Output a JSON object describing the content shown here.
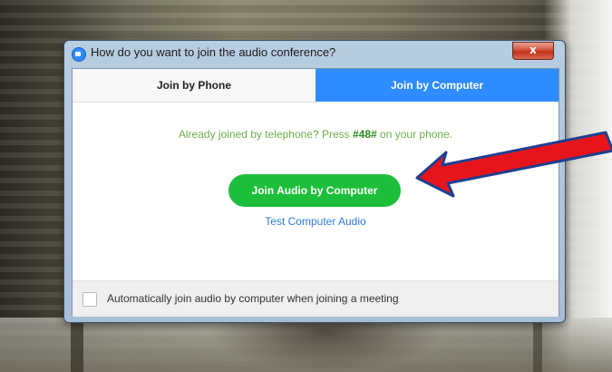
{
  "dialog": {
    "title": "How do you want to join the audio conference?",
    "close_label": "x",
    "tabs": [
      {
        "label": "Join by Phone",
        "selected": false
      },
      {
        "label": "Join by Computer",
        "selected": true
      }
    ],
    "status": {
      "prefix": "Already joined by telephone? Press ",
      "code": "#48#",
      "suffix": " on your phone."
    },
    "join_button_label": "Join Audio by Computer",
    "test_link_label": "Test Computer Audio",
    "auto_join": {
      "label": "Automatically join audio by computer when joining a meeting",
      "checked": false
    }
  },
  "colors": {
    "accent_blue": "#2d8cff",
    "join_green": "#1dbf3a",
    "status_green": "#6ab04c",
    "link_blue": "#2d7dd2",
    "annotation_red": "#e8141c",
    "annotation_outline": "#1f3f8f"
  },
  "icons": {
    "app": "zoom-camera-icon",
    "close": "close-icon",
    "annotation": "red-arrow-pointer"
  }
}
